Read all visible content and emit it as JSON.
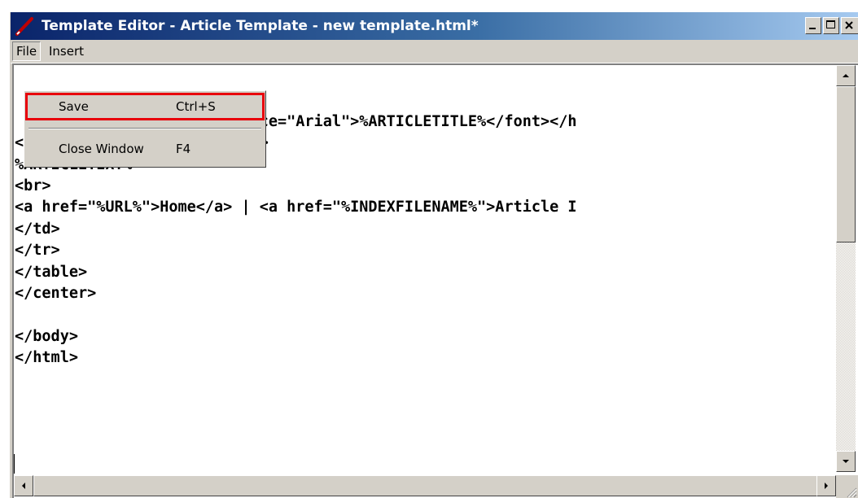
{
  "window": {
    "title": "Template Editor - Article Template - new template.html*",
    "icon": "pencil-icon"
  },
  "menubar": {
    "items": [
      {
        "label": "File",
        "open": true
      },
      {
        "label": "Insert",
        "open": false
      }
    ]
  },
  "file_menu": {
    "items": [
      {
        "label": "Save",
        "shortcut": "Ctrl+S",
        "highlighted": true
      },
      {
        "label": "Close Window",
        "shortcut": "F4",
        "highlighted": false
      }
    ],
    "highlight_color": "#e8000b"
  },
  "editor": {
    "lines": [
      "",
      "",
      "                  ><font face=\"Arial\">%ARTICLETITLE%</font></h",
      "<font face=\"Arial\" size=\"2\">",
      "%ARTICLETEXT%",
      "<br>",
      "<a href=\"%URL%\">Home</a> | <a href=\"%INDEXFILENAME%\">Article I",
      "</td>",
      "</tr>",
      "</table>",
      "</center>",
      "",
      "</body>",
      "</html>",
      "",
      "",
      ""
    ]
  },
  "colors": {
    "titlebar_start": "#0a246a",
    "titlebar_end": "#a6caf0",
    "chrome": "#d4d0c8"
  }
}
